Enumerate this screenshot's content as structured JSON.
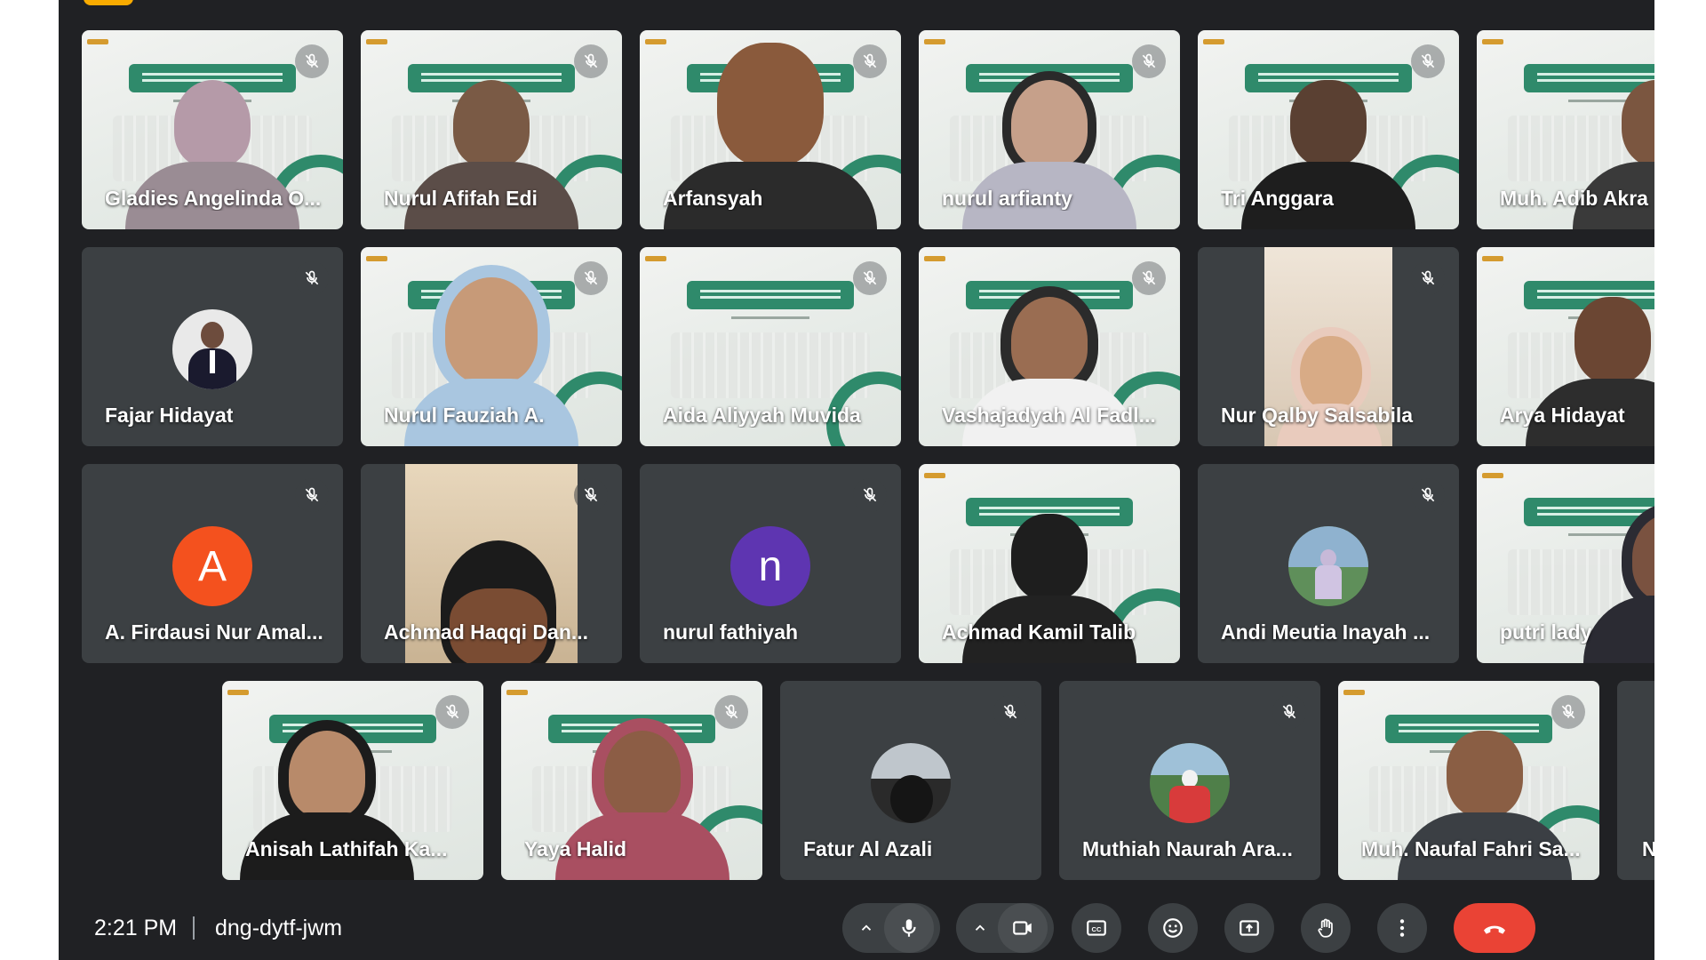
{
  "meeting": {
    "time": "2:21 PM",
    "code": "dng-dytf-jwm"
  },
  "colors": {
    "background": "#202124",
    "tile": "#3c4043",
    "slide_green": "#2f8a6b",
    "end_call": "#ea4335",
    "avatar_orange": "#f4511e",
    "avatar_purple": "#5e35b1"
  },
  "participants": [
    {
      "name": "Gladies Angelinda O...",
      "kind": "video",
      "muted": true
    },
    {
      "name": "Nurul Afifah Edi",
      "kind": "video",
      "muted": true
    },
    {
      "name": "Arfansyah",
      "kind": "video",
      "muted": true
    },
    {
      "name": "nurul arfianty",
      "kind": "video",
      "muted": true
    },
    {
      "name": "Tri Anggara",
      "kind": "video",
      "muted": true
    },
    {
      "name": "Muh. Adib Akra",
      "kind": "video",
      "muted": false
    },
    {
      "name": "Fajar Hidayat",
      "kind": "photo",
      "muted": true
    },
    {
      "name": "Nurul Fauziah A.",
      "kind": "video",
      "muted": true
    },
    {
      "name": "Aida Aliyyah Muvida",
      "kind": "video",
      "muted": true
    },
    {
      "name": "Vashajadyah Al Fadl...",
      "kind": "video",
      "muted": true
    },
    {
      "name": "Nur Qalby Salsabila",
      "kind": "cam",
      "muted": true
    },
    {
      "name": "Arya Hidayat",
      "kind": "video",
      "muted": false
    },
    {
      "name": "A. Firdausi Nur Amal...",
      "kind": "letter",
      "letter": "A",
      "muted": true
    },
    {
      "name": "Achmad Haqqi Dan...",
      "kind": "cam",
      "muted": true
    },
    {
      "name": "nurul fathiyah",
      "kind": "letter",
      "letter": "n",
      "muted": true
    },
    {
      "name": "Achmad Kamil Talib",
      "kind": "video",
      "muted": false
    },
    {
      "name": "Andi Meutia Inayah ...",
      "kind": "photo",
      "muted": true
    },
    {
      "name": "putri lady",
      "kind": "video",
      "muted": false
    },
    {
      "name": "Anisah Lathifah Ka...",
      "kind": "video",
      "muted": true
    },
    {
      "name": "Yaya Halid",
      "kind": "video",
      "muted": true
    },
    {
      "name": "Fatur Al Azali",
      "kind": "photo",
      "muted": true
    },
    {
      "name": "Muthiah Naurah Ara...",
      "kind": "photo",
      "muted": true
    },
    {
      "name": "Muh. Naufal Fahri Sa...",
      "kind": "video",
      "muted": true
    },
    {
      "name": "N",
      "kind": "cam",
      "muted": false
    }
  ],
  "controls": [
    {
      "name": "more-audio-options",
      "icon": "chevron-up-icon"
    },
    {
      "name": "microphone",
      "icon": "mic-icon"
    },
    {
      "name": "more-video-options",
      "icon": "chevron-up-icon"
    },
    {
      "name": "camera",
      "icon": "camera-icon"
    },
    {
      "name": "captions",
      "icon": "closed-caption-icon"
    },
    {
      "name": "reactions",
      "icon": "emoji-icon"
    },
    {
      "name": "present-screen",
      "icon": "present-icon"
    },
    {
      "name": "raise-hand",
      "icon": "hand-icon"
    },
    {
      "name": "more-options",
      "icon": "more-vert-icon"
    },
    {
      "name": "leave-call",
      "icon": "phone-hangup-icon"
    }
  ]
}
